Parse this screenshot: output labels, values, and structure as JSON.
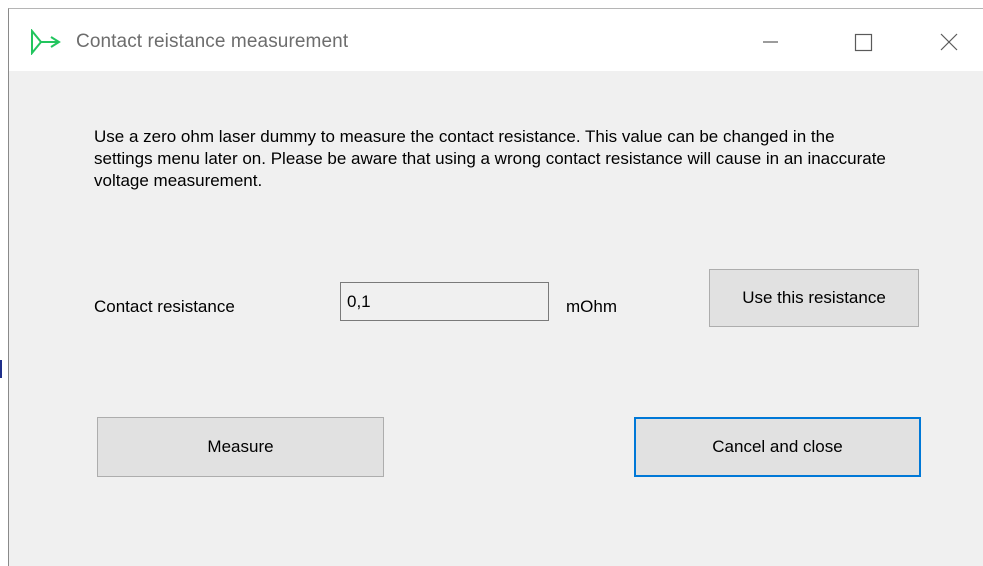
{
  "window": {
    "title": "Contact reistance measurement"
  },
  "icons": {
    "app": "app-icon",
    "minimize": "minimize-icon",
    "maximize": "maximize-icon",
    "close": "close-icon"
  },
  "main": {
    "instructions": "Use a zero ohm laser dummy to measure the contact resistance. This value can be changed in the settings menu later on. Please be aware that using a wrong contact resistance will cause in an inaccurate voltage measurement.",
    "resistance_label": "Contact resistance",
    "resistance_value": "0,1",
    "resistance_unit": "mOhm",
    "use_button_label": "Use this resistance",
    "measure_button_label": "Measure",
    "cancel_button_label": "Cancel and close"
  },
  "colors": {
    "window_bg": "#f0f0f0",
    "titlebar_bg": "#ffffff",
    "button_bg": "#e1e1e1",
    "focus_border": "#0078d7",
    "icon_green": "#22c55e"
  }
}
